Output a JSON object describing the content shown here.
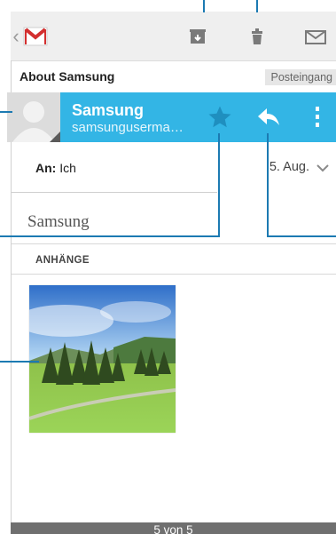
{
  "toolbar": {
    "back_chevron": "‹",
    "app_icon": "gmail-logo-icon",
    "archive_icon": "archive-icon",
    "delete_icon": "trash-icon",
    "mark_unread_icon": "mark-unread-icon",
    "bg": "#efefef"
  },
  "message": {
    "subject": "About Samsung",
    "label": "Posteingang",
    "sender_name": "Samsung",
    "sender_email": "samsungusermа…",
    "accent": "#33b5e5",
    "star_icon": "star-icon",
    "reply_icon": "reply-icon",
    "overflow_icon": "overflow-menu-icon",
    "to_label": "An:",
    "to_value": "Ich",
    "date": "5. Aug.",
    "date_chevron": "⌄",
    "body": "Samsung",
    "attachments_header": "ANHÄNGE"
  },
  "footer": {
    "pager": "5 von 5"
  },
  "callout_color": "#1c7ab2"
}
